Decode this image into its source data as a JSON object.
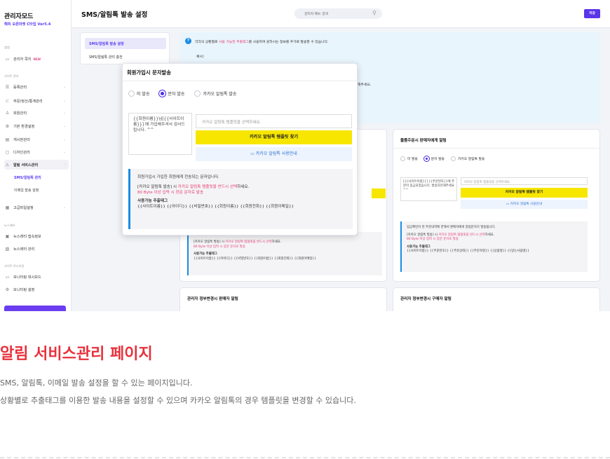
{
  "sidebar": {
    "brand_title": "관리자모드",
    "brand_sub": "해피 오픈마켓 C타입 Ver5.4",
    "section1": "앱앱",
    "item_notice": "관리자 쪽지",
    "item_notice_badge": "NEW",
    "section2": "사이트 관리",
    "items": [
      {
        "label": "등록관리",
        "icon": "list-icon"
      },
      {
        "label": "주문/정산/통계관리",
        "icon": "cart-icon"
      },
      {
        "label": "회원관리",
        "icon": "user-icon"
      },
      {
        "label": "기본 환경설정",
        "icon": "gear-icon"
      },
      {
        "label": "게시판관리",
        "icon": "board-icon"
      },
      {
        "label": "디자인관리",
        "icon": "design-icon"
      },
      {
        "label": "알림 서비스관리",
        "icon": "bell-icon"
      }
    ],
    "sub_items": [
      "SMS/알림톡 관리",
      "이메일 발송 설정"
    ],
    "item_advanced": "고급파일설정",
    "section3": "뉴스레터",
    "news_items": [
      "뉴스레터 접속정보",
      "뉴스레터 관리"
    ],
    "section4": "사이트 모니터링",
    "mon_items": [
      "모니터링 대시보드",
      "모니터링 설정"
    ]
  },
  "header": {
    "title": "SMS/알림톡 발송 설정",
    "search_placeholder": "관리자 메뉴 검색",
    "save_label": "저장"
  },
  "tabs": [
    "SMS/알림톡 발송 설정",
    "SMS/알림톡 관리 충전"
  ],
  "info": {
    "text_before": "각각의 상황별로 ",
    "text_highlight": "사용 가능한 추출태그",
    "text_after": "를 사용하여 원하시는 정보를 주가로 발송할 수 있습니다.",
    "example": "예시)",
    "tail": "해주세요."
  },
  "popup": {
    "title": "회원가입시 문자발송",
    "radio_none": "미 발송",
    "radio_sms": "문자 발송",
    "radio_kakao": "카카오 알림톡 발송",
    "template_text": "{{회원이름}}님[{{사이트이름}}] 에 가입해주셔서 감사드립니다. ^^",
    "select_placeholder": "카카오 알림톡 템플릿을 선택하세요.",
    "find_button": "카카오 알림톡 템플릿 찾기",
    "guide_button": "카카오 알림톡 사용안내",
    "note_line1": "회원가입시 가입한 회원에게 전송되는 문자입니다.",
    "note_line2_prefix": "[카카오 알림톡 발송] 시 ",
    "note_line2_hl": "카카오 알림톡 템플릿을 반드시 선택",
    "note_line2_suffix": "하세요.",
    "note_line3": "80 Byte 이상 입력 시 장문 문자로 발송",
    "tags_title": "사용가능 추출태그",
    "tags": "{{사이트이름}} {{아이디}} {{비밀번호}} {{회원이름}} {{회원전화}} {{회원이메일}}"
  },
  "card_right": {
    "title": "물품주문시 판매자에게 알림",
    "radio_none": "미 발송",
    "radio_sms": "문자 발송",
    "radio_kakao": "카카오 알림톡 발송",
    "template_text": "[{{사이트이름}}] {{주문번호}}에 주문이 입금되었습니다. 발송처리해주세요 ^^",
    "select_placeholder": "카카오 알림톡 템플릿을 선택하세요.",
    "find_button": "카카오 알림톡 템플릿 찾기",
    "guide_button": "카카오 알림톡 사용안내",
    "note_line1": "입금확인이 된 주문내역에 한해서 판매자에게 알림문자가 발송됩니다.",
    "note_line2_prefix": "[카카오 알림톡 발송] 시 ",
    "note_line2_hl": "카카오 알림톡 템플릿을 반드시 선택",
    "note_line2_suffix": "하세요.",
    "note_line3": "80 Byte 이상 입력 시 장문 문자로 발송",
    "tags_title": "사용가능 추출태그",
    "tags": "{{사이트이름}} {{주문번호}} {{주문상태}} {{주문자명}} {{상품명}} {{받는사람명}}"
  },
  "card_left_bg": {
    "note_line2_prefix": "[카카오 알림톡 발송] 시 ",
    "note_line2_hl": "카카오 알림톡 템플릿을 반드시 선택",
    "note_line2_suffix": "하세요.",
    "note_line3": "80 Byte 이상 입력 시 장문 문자로 발송",
    "tags_title": "사용가능 추출태그",
    "tags": "{{사이트이름}} {{아이디}} {{비밀번호}} {{회원이름}} {{회원전화}} {{회원이메일}}"
  },
  "bottom_cards": [
    "관리자 정부변경시 판매자 알림",
    "관리자 정부변경시 구매자 알림"
  ],
  "page": {
    "heading": "알림 서비스관리 페이지",
    "desc1": "SMS, 알림톡, 이메일 발송 설정을 할 수 있는 페이지입니다.",
    "desc2": "상황별로 추출태그를 이용한 발송 내용을 설정할 수 있으며 카카오 알림톡의 경우 템플릿을 변경할 수 있습니다."
  },
  "colors": {
    "accent": "#5b35e8",
    "highlight": "#e63b6f",
    "kakao": "#f7e600",
    "heading": "#e8313c"
  }
}
